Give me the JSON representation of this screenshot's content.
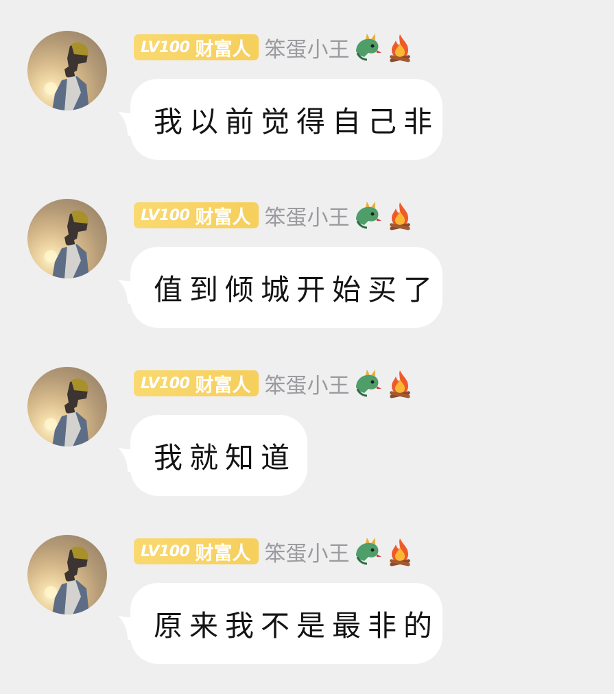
{
  "messages": [
    {
      "level": "LV100",
      "title": "财富人",
      "username": "笨蛋小王",
      "icons": [
        "dragon-icon",
        "fire-icon"
      ],
      "text": "我以前觉得自己非"
    },
    {
      "level": "LV100",
      "title": "财富人",
      "username": "笨蛋小王",
      "icons": [
        "dragon-icon",
        "fire-icon"
      ],
      "text": "值到倾城开始买了"
    },
    {
      "level": "LV100",
      "title": "财富人",
      "username": "笨蛋小王",
      "icons": [
        "dragon-icon",
        "fire-icon"
      ],
      "text": "我就知道"
    },
    {
      "level": "LV100",
      "title": "财富人",
      "username": "笨蛋小王",
      "icons": [
        "dragon-icon",
        "fire-icon"
      ],
      "text": "原来我不是最非的"
    }
  ],
  "colors": {
    "background": "#efeff0",
    "badge": "#f6cf5c",
    "username": "#9b9b9f",
    "bubble": "#ffffff"
  }
}
